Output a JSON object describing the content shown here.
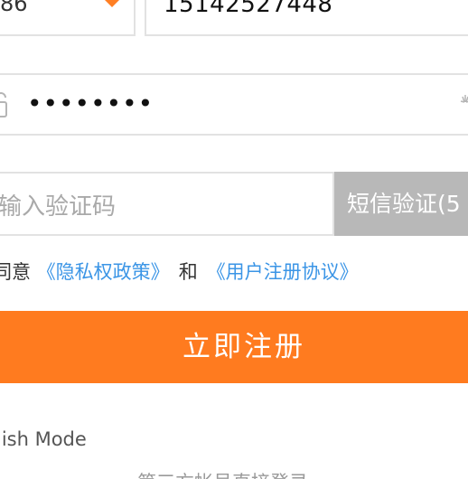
{
  "form": {
    "country_code": "86",
    "phone": "15142527448",
    "password_masked": "••••••••",
    "code_placeholder": "输入验证码",
    "sms_button_label": "短信验证(5"
  },
  "agreement": {
    "prefix": "同意",
    "privacy_link": "《隐私权政策》",
    "and": "和",
    "terms_link": "《用户注册协议》"
  },
  "actions": {
    "register_label": "立即注册"
  },
  "footer": {
    "english_mode": "lish Mode",
    "third_party": "第三方帐号直接登录"
  },
  "colors": {
    "accent": "#ff7b1f",
    "link": "#3b95e6",
    "sms_disabled": "#b8b8b8"
  }
}
